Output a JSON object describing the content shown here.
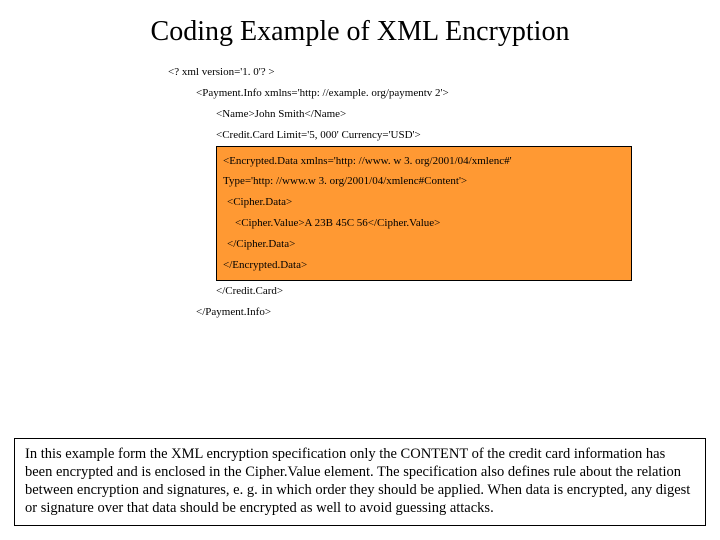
{
  "title": "Coding Example of XML Encryption",
  "code": {
    "l1": "<? xml version='1. 0'? >",
    "l2": "<Payment.Info xmlns='http: //example. org/paymentv 2'>",
    "l3": "<Name>John Smith</Name>",
    "l4": "<Credit.Card Limit='5, 000' Currency='USD'>",
    "enc": {
      "e1": "<Encrypted.Data xmlns='http: //www. w 3. org/2001/04/xmlenc#'",
      "e2": "Type='http: //www.w 3. org/2001/04/xmlenc#Content'>",
      "e3": "<Cipher.Data>",
      "e4": "<Cipher.Value>A 23B 45C 56</Cipher.Value>",
      "e5": "</Cipher.Data>",
      "e6": "</Encrypted.Data>"
    },
    "l5": "</Credit.Card>",
    "l6": "</Payment.Info>"
  },
  "note": "In this example form the XML encryption specification only the CONTENT of the credit card information has been encrypted and is enclosed in the Cipher.Value element. The specification also defines rule about the relation between encryption and signatures, e. g. in which order they should be applied. When data is encrypted, any digest or signature over that data should be encrypted as well to avoid guessing attacks."
}
